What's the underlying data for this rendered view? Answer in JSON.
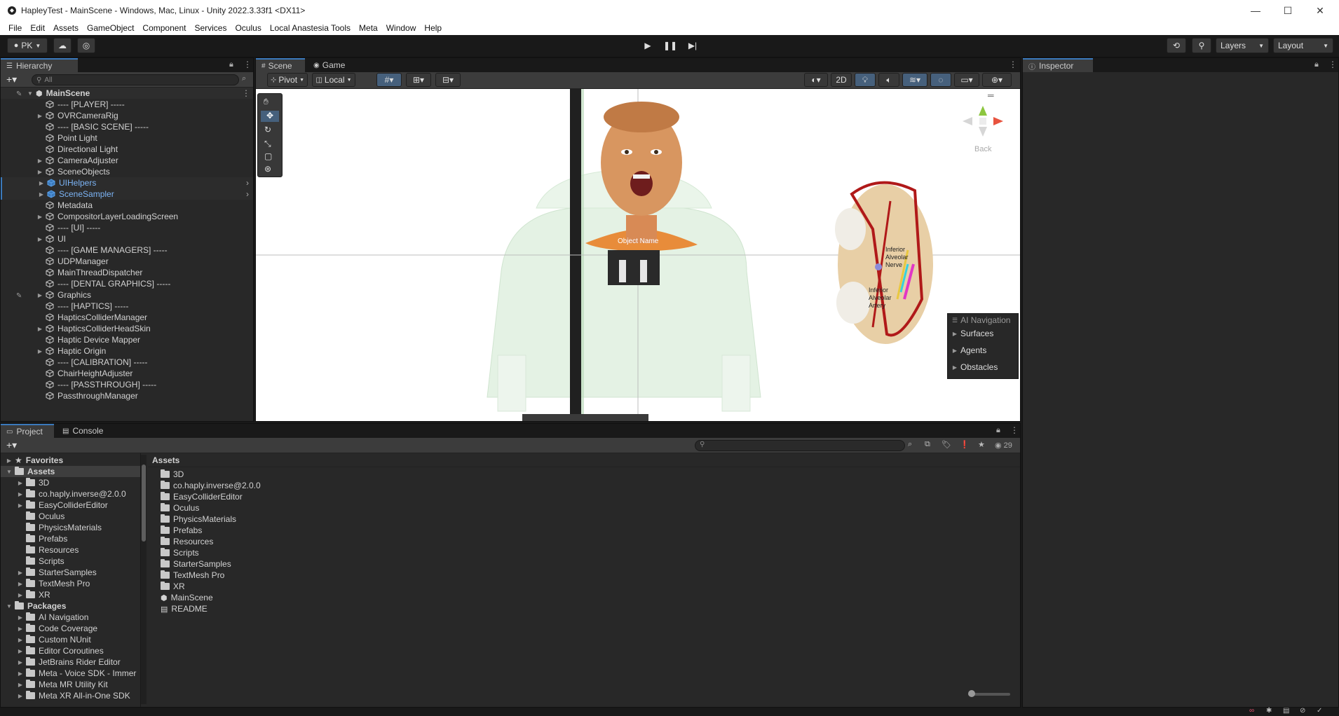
{
  "window": {
    "title": "HapleyTest - MainScene - Windows, Mac, Linux - Unity 2022.3.33f1 <DX11>",
    "controls": [
      "—",
      "☐",
      "✕"
    ]
  },
  "menu": [
    "File",
    "Edit",
    "Assets",
    "GameObject",
    "Component",
    "Services",
    "Oculus",
    "Local Anastesia Tools",
    "Meta",
    "Window",
    "Help"
  ],
  "toolbar": {
    "account": "PK",
    "layers": "Layers",
    "layout": "Layout"
  },
  "hierarchy": {
    "tab": "Hierarchy",
    "search_placeholder": "All",
    "scene": "MainScene",
    "items": [
      {
        "label": "---- [PLAYER] -----",
        "expand": false,
        "selected": false
      },
      {
        "label": "OVRCameraRig",
        "expand": true,
        "selected": false
      },
      {
        "label": "---- [BASIC SCENE] -----",
        "expand": false,
        "selected": false
      },
      {
        "label": "Point Light",
        "expand": false,
        "selected": false
      },
      {
        "label": "Directional Light",
        "expand": false,
        "selected": false
      },
      {
        "label": "CameraAdjuster",
        "expand": true,
        "selected": false
      },
      {
        "label": "SceneObjects",
        "expand": true,
        "selected": false
      },
      {
        "label": "UIHelpers",
        "expand": true,
        "selected": true
      },
      {
        "label": "SceneSampler",
        "expand": true,
        "selected": true
      },
      {
        "label": "Metadata",
        "expand": false,
        "selected": false
      },
      {
        "label": "CompositorLayerLoadingScreen",
        "expand": true,
        "selected": false
      },
      {
        "label": "---- [UI] -----",
        "expand": false,
        "selected": false
      },
      {
        "label": "UI",
        "expand": true,
        "selected": false
      },
      {
        "label": "---- [GAME MANAGERS] -----",
        "expand": false,
        "selected": false
      },
      {
        "label": "UDPManager",
        "expand": false,
        "selected": false
      },
      {
        "label": "MainThreadDispatcher",
        "expand": false,
        "selected": false
      },
      {
        "label": "---- [DENTAL GRAPHICS] -----",
        "expand": false,
        "selected": false
      },
      {
        "label": "Graphics",
        "expand": true,
        "selected": false
      },
      {
        "label": "---- [HAPTICS] -----",
        "expand": false,
        "selected": false
      },
      {
        "label": "HapticsColliderManager",
        "expand": false,
        "selected": false
      },
      {
        "label": "HapticsColliderHeadSkin",
        "expand": true,
        "selected": false
      },
      {
        "label": "Haptic Device Mapper",
        "expand": false,
        "selected": false
      },
      {
        "label": "Haptic Origin",
        "expand": true,
        "selected": false
      },
      {
        "label": "---- [CALIBRATION] -----",
        "expand": false,
        "selected": false
      },
      {
        "label": "ChairHeightAdjuster",
        "expand": false,
        "selected": false
      },
      {
        "label": "---- [PASSTHROUGH] -----",
        "expand": false,
        "selected": false
      },
      {
        "label": "PassthroughManager",
        "expand": false,
        "selected": false
      }
    ]
  },
  "scene": {
    "tabs": [
      "Scene",
      "Game"
    ],
    "pivot": "Pivot",
    "local": "Local",
    "mode_2d": "2D",
    "gizmo_label": "Back",
    "object_name": "Object Name",
    "anatomy_labels": [
      "Inferior Alveolar Nerve",
      "Inferior Alveolar Artery"
    ],
    "ai_navigation": {
      "title": "AI Navigation",
      "items": [
        "Surfaces",
        "Agents",
        "Obstacles"
      ]
    }
  },
  "inspector": {
    "tab": "Inspector"
  },
  "project": {
    "tabs": [
      "Project",
      "Console"
    ],
    "count": "29",
    "tree": [
      {
        "label": "Favorites",
        "level": 0,
        "kind": "star"
      },
      {
        "label": "Assets",
        "level": 0,
        "kind": "folder",
        "selected": true
      },
      {
        "label": "3D",
        "level": 1,
        "kind": "folder"
      },
      {
        "label": "co.haply.inverse@2.0.0",
        "level": 1,
        "kind": "folder"
      },
      {
        "label": "EasyColliderEditor",
        "level": 1,
        "kind": "folder"
      },
      {
        "label": "Oculus",
        "level": 1,
        "kind": "folder"
      },
      {
        "label": "PhysicsMaterials",
        "level": 1,
        "kind": "folder"
      },
      {
        "label": "Prefabs",
        "level": 1,
        "kind": "folder"
      },
      {
        "label": "Resources",
        "level": 1,
        "kind": "folder"
      },
      {
        "label": "Scripts",
        "level": 1,
        "kind": "folder"
      },
      {
        "label": "StarterSamples",
        "level": 1,
        "kind": "folder"
      },
      {
        "label": "TextMesh Pro",
        "level": 1,
        "kind": "folder"
      },
      {
        "label": "XR",
        "level": 1,
        "kind": "folder"
      },
      {
        "label": "Packages",
        "level": 0,
        "kind": "folder"
      },
      {
        "label": "AI Navigation",
        "level": 1,
        "kind": "folder"
      },
      {
        "label": "Code Coverage",
        "level": 1,
        "kind": "folder"
      },
      {
        "label": "Custom NUnit",
        "level": 1,
        "kind": "folder"
      },
      {
        "label": "Editor Coroutines",
        "level": 1,
        "kind": "folder"
      },
      {
        "label": "JetBrains Rider Editor",
        "level": 1,
        "kind": "folder"
      },
      {
        "label": "Meta - Voice SDK - Immer",
        "level": 1,
        "kind": "folder"
      },
      {
        "label": "Meta MR Utility Kit",
        "level": 1,
        "kind": "folder"
      },
      {
        "label": "Meta XR All-in-One SDK",
        "level": 1,
        "kind": "folder"
      }
    ],
    "breadcrumb": "Assets",
    "files": [
      {
        "label": "3D",
        "kind": "folder"
      },
      {
        "label": "co.haply.inverse@2.0.0",
        "kind": "folder"
      },
      {
        "label": "EasyColliderEditor",
        "kind": "folder"
      },
      {
        "label": "Oculus",
        "kind": "folder"
      },
      {
        "label": "PhysicsMaterials",
        "kind": "folder"
      },
      {
        "label": "Prefabs",
        "kind": "folder"
      },
      {
        "label": "Resources",
        "kind": "folder"
      },
      {
        "label": "Scripts",
        "kind": "folder"
      },
      {
        "label": "StarterSamples",
        "kind": "folder"
      },
      {
        "label": "TextMesh Pro",
        "kind": "folder"
      },
      {
        "label": "XR",
        "kind": "folder"
      },
      {
        "label": "MainScene",
        "kind": "scene"
      },
      {
        "label": "README",
        "kind": "doc"
      }
    ]
  },
  "colors": {
    "accent": "#3a79bb",
    "selected_text": "#7cb4f5",
    "panel": "#282828"
  }
}
